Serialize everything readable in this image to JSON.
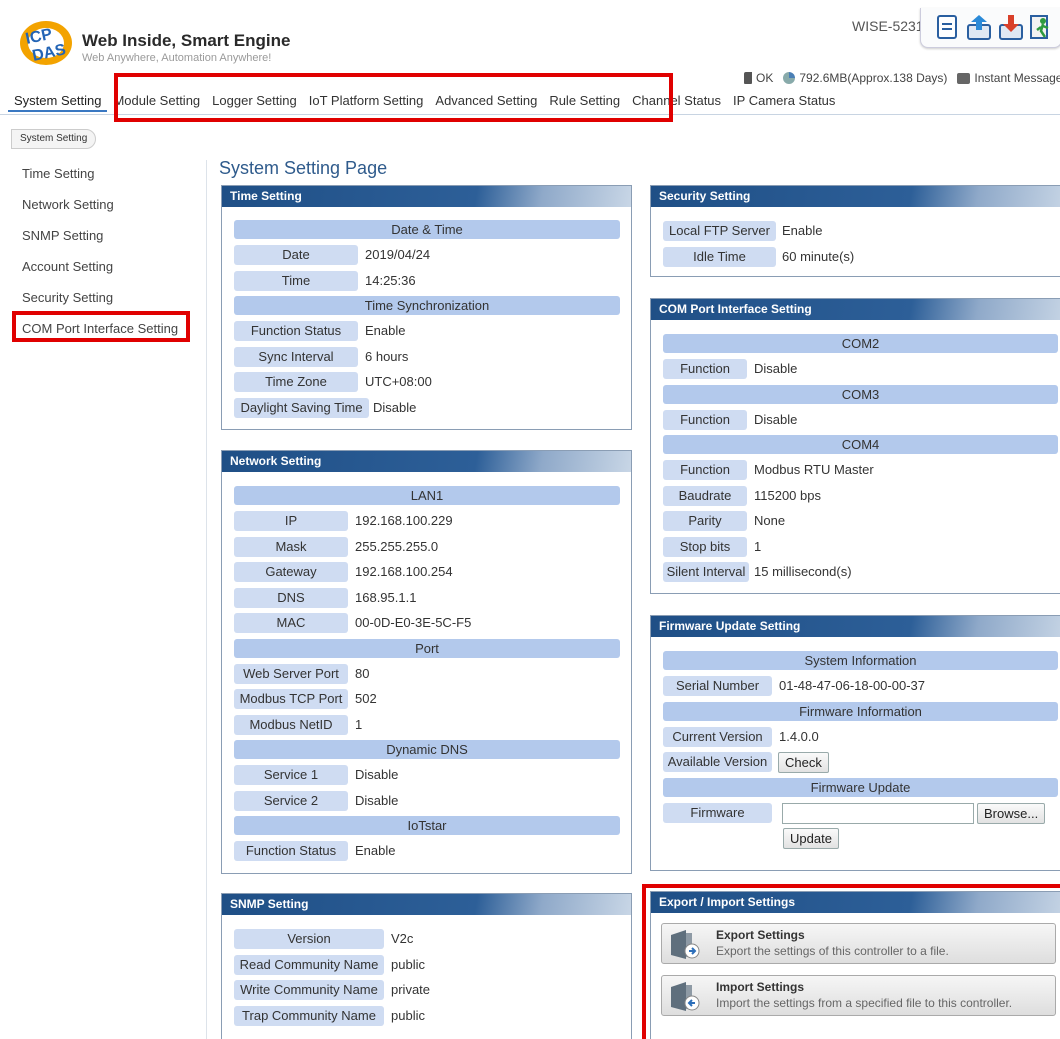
{
  "brand": {
    "title": "Web Inside, Smart Engine",
    "subtitle": "Web Anywhere, Automation Anywhere!",
    "model": "WISE-5231"
  },
  "toolbar": {
    "icons": [
      "document-icon",
      "upload-icon",
      "download-icon",
      "logout-icon"
    ]
  },
  "status": {
    "ok": "OK",
    "storage": "792.6MB(Approx.138 Days)",
    "message": "Instant Message"
  },
  "nav": {
    "items": [
      "System Setting",
      "Module Setting",
      "Logger Setting",
      "IoT Platform Setting",
      "Advanced Setting",
      "Rule Setting",
      "Channel Status",
      "IP Camera Status"
    ]
  },
  "breadcrumb": "System Setting",
  "sidebar": {
    "items": [
      "Time Setting",
      "Network Setting",
      "SNMP Setting",
      "Account Setting",
      "Security Setting",
      "COM Port Interface Setting"
    ]
  },
  "page_title": "System Setting Page",
  "time": {
    "title": "Time Setting",
    "sec1": "Date & Time",
    "date_l": "Date",
    "date_v": "2019/04/24",
    "time_l": "Time",
    "time_v": "14:25:36",
    "sec2": "Time Synchronization",
    "fs_l": "Function Status",
    "fs_v": "Enable",
    "si_l": "Sync Interval",
    "si_v": "6 hours",
    "tz_l": "Time Zone",
    "tz_v": "UTC+08:00",
    "dst_l": "Daylight Saving Time",
    "dst_v": "Disable"
  },
  "network": {
    "title": "Network Setting",
    "lan": "LAN1",
    "ip_l": "IP",
    "ip_v": "192.168.100.229",
    "mask_l": "Mask",
    "mask_v": "255.255.255.0",
    "gw_l": "Gateway",
    "gw_v": "192.168.100.254",
    "dns_l": "DNS",
    "dns_v": "168.95.1.1",
    "mac_l": "MAC",
    "mac_v": "00-0D-E0-3E-5C-F5",
    "port": "Port",
    "wsp_l": "Web Server Port",
    "wsp_v": "80",
    "mtp_l": "Modbus TCP Port",
    "mtp_v": "502",
    "mnid_l": "Modbus NetID",
    "mnid_v": "1",
    "ddns": "Dynamic DNS",
    "s1_l": "Service 1",
    "s1_v": "Disable",
    "s2_l": "Service 2",
    "s2_v": "Disable",
    "iot": "IoTstar",
    "ifs_l": "Function Status",
    "ifs_v": "Enable"
  },
  "snmp": {
    "title": "SNMP Setting",
    "ver_l": "Version",
    "ver_v": "V2c",
    "rc_l": "Read Community Name",
    "rc_v": "public",
    "wc_l": "Write Community Name",
    "wc_v": "private",
    "tc_l": "Trap Community Name",
    "tc_v": "public"
  },
  "security": {
    "title": "Security Setting",
    "ftp_l": "Local FTP Server",
    "ftp_v": "Enable",
    "idle_l": "Idle Time",
    "idle_v": "60 minute(s)"
  },
  "com": {
    "title": "COM Port Interface Setting",
    "com2": "COM2",
    "f2_l": "Function",
    "f2_v": "Disable",
    "com3": "COM3",
    "f3_l": "Function",
    "f3_v": "Disable",
    "com4": "COM4",
    "f4_l": "Function",
    "f4_v": "Modbus RTU Master",
    "baud_l": "Baudrate",
    "baud_v": "115200 bps",
    "par_l": "Parity",
    "par_v": "None",
    "stop_l": "Stop bits",
    "stop_v": "1",
    "sil_l": "Silent Interval",
    "sil_v": "15 millisecond(s)"
  },
  "firmware": {
    "title": "Firmware Update Setting",
    "sysinfo": "System Information",
    "sn_l": "Serial Number",
    "sn_v": "01-48-47-06-18-00-00-37",
    "fwinfo": "Firmware Information",
    "cv_l": "Current Version",
    "cv_v": "1.4.0.0",
    "av_l": "Available Version",
    "check": "Check",
    "fwupd": "Firmware Update",
    "fw_l": "Firmware",
    "browse": "Browse...",
    "update": "Update"
  },
  "exportimport": {
    "title": "Export / Import Settings",
    "exp_t": "Export Settings",
    "exp_d": "Export the settings of this controller to a file.",
    "imp_t": "Import Settings",
    "imp_d": "Import the settings from a specified file to this controller."
  },
  "colors": {
    "highlight": "#e00000",
    "panel_header": "#1f4f86",
    "label_bg": "#cfdcf2",
    "section_bg": "#b3c9ec",
    "title": "#2f5b8c"
  }
}
